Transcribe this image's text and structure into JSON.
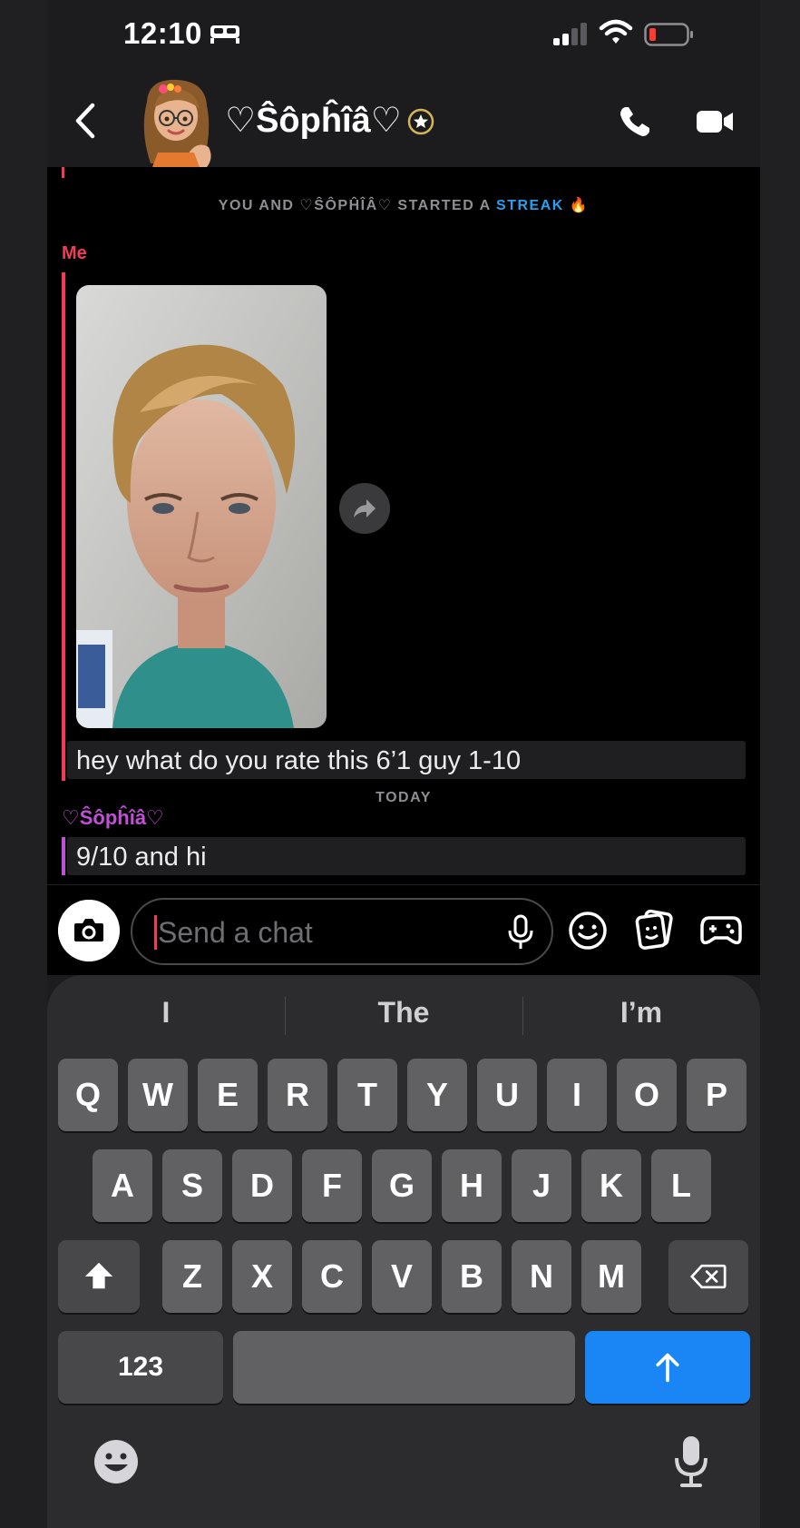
{
  "status_bar": {
    "time": "12:10"
  },
  "header": {
    "contact_name": "♡Ŝôpĥîâ♡"
  },
  "chat": {
    "streak_note_prefix": "YOU AND ♡ŜÔPĤÎÂ♡ STARTED A ",
    "streak_note_word": "STREAK",
    "streak_note_emoji": "🔥",
    "my_label": "Me",
    "my_message": "hey what do you rate this 6’1 guy 1-10",
    "day_separator": "TODAY",
    "their_label": "♡Ŝôpĥîâ♡",
    "their_message": "9/10 and hi"
  },
  "input": {
    "placeholder": "Send a chat"
  },
  "keyboard": {
    "suggestions": [
      "I",
      "The",
      "I’m"
    ],
    "row1": [
      "Q",
      "W",
      "E",
      "R",
      "T",
      "Y",
      "U",
      "I",
      "O",
      "P"
    ],
    "row2": [
      "A",
      "S",
      "D",
      "F",
      "G",
      "H",
      "J",
      "K",
      "L"
    ],
    "row3": [
      "Z",
      "X",
      "C",
      "V",
      "B",
      "N",
      "M"
    ],
    "numbers_key": "123"
  },
  "colors": {
    "my_accent": "#f23c57",
    "their_accent": "#c24fd8",
    "streak_blue": "#28a0f0",
    "send_key": "#1a86f5"
  },
  "icons": [
    "back-icon",
    "call-icon",
    "video-icon",
    "camera-icon",
    "mic-icon",
    "emoji-icon",
    "sticker-icon",
    "game-icon",
    "shift-icon",
    "backspace-icon",
    "send-arrow-icon"
  ]
}
